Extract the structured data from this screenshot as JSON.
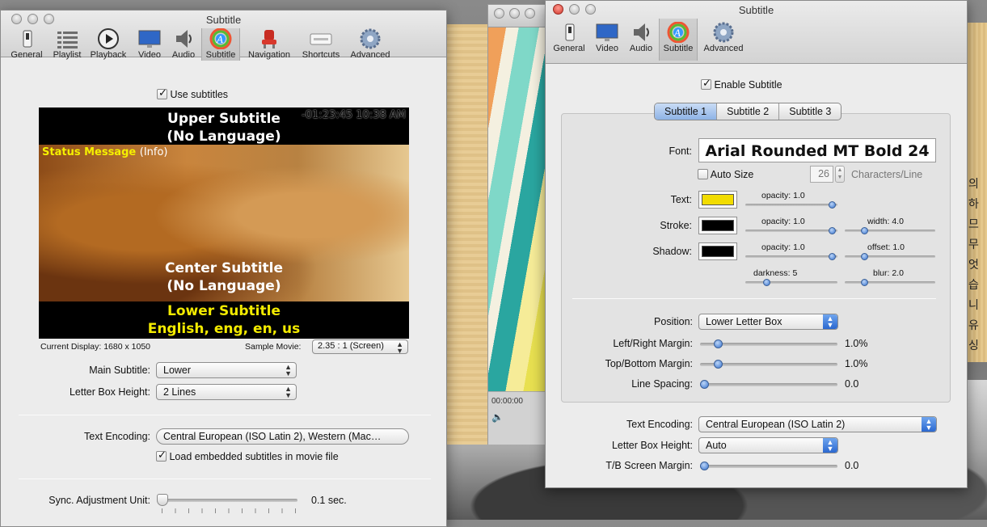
{
  "left_window": {
    "title": "Subtitle",
    "toolbar": [
      {
        "label": "General",
        "icon": "switch-icon"
      },
      {
        "label": "Playlist",
        "icon": "playlist-icon"
      },
      {
        "label": "Playback",
        "icon": "play-icon"
      },
      {
        "label": "Video",
        "icon": "monitor-icon"
      },
      {
        "label": "Audio",
        "icon": "speaker-icon"
      },
      {
        "label": "Subtitle",
        "icon": "color-wheel-icon"
      },
      {
        "label": "Navigation",
        "icon": "chair-icon"
      },
      {
        "label": "Shortcuts",
        "icon": "keyboard-icon"
      },
      {
        "label": "Advanced",
        "icon": "gear-icon"
      }
    ],
    "use_subtitles_label": "Use subtitles",
    "preview": {
      "upper_line1": "Upper Subtitle",
      "upper_line2": "(No Language)",
      "time_overlay": "-01:23:45   10:38 AM",
      "status_message": "Status Message",
      "status_info": "(Info)",
      "center_line1": "Center Subtitle",
      "center_line2": "(No Language)",
      "lower_line1": "Lower Subtitle",
      "lower_line2": "English, eng, en, us"
    },
    "current_display": "Current Display: 1680 x 1050",
    "sample_movie_label": "Sample Movie:",
    "sample_movie_value": "2.35 : 1 (Screen)",
    "main_subtitle_label": "Main Subtitle:",
    "main_subtitle_value": "Lower",
    "letter_box_height_label": "Letter Box Height:",
    "letter_box_height_value": "2 Lines",
    "text_encoding_label": "Text Encoding:",
    "text_encoding_value": "Central European (ISO Latin 2), Western (Mac…",
    "load_embedded_label": "Load embedded subtitles in movie file",
    "sync_label": "Sync. Adjustment Unit:",
    "sync_value": "0.1 sec."
  },
  "movie_window": {
    "time": "00:00:00"
  },
  "right_window": {
    "title": "Subtitle",
    "toolbar": [
      {
        "label": "General",
        "icon": "switch-icon"
      },
      {
        "label": "Video",
        "icon": "monitor-icon"
      },
      {
        "label": "Audio",
        "icon": "speaker-icon"
      },
      {
        "label": "Subtitle",
        "icon": "color-wheel-icon"
      },
      {
        "label": "Advanced",
        "icon": "gear-icon"
      }
    ],
    "enable_subtitle_label": "Enable Subtitle",
    "tabs": [
      "Subtitle 1",
      "Subtitle 2",
      "Subtitle 3"
    ],
    "font_label": "Font:",
    "font_value": "Arial Rounded MT Bold 24",
    "auto_size_label": "Auto Size",
    "chars_value": "26",
    "chars_label": "Characters/Line",
    "text_label": "Text:",
    "text_color": "#f2dc00",
    "text_opacity": "opacity:  1.0",
    "stroke_label": "Stroke:",
    "stroke_color": "#000000",
    "stroke_opacity": "opacity:  1.0",
    "stroke_width": "width:  4.0",
    "shadow_label": "Shadow:",
    "shadow_color": "#000000",
    "shadow_opacity": "opacity:  1.0",
    "shadow_offset": "offset:  1.0",
    "shadow_darkness": "darkness:  5",
    "shadow_blur": "blur:  2.0",
    "position_label": "Position:",
    "position_value": "Lower Letter Box",
    "lr_margin_label": "Left/Right Margin:",
    "lr_margin_value": "1.0%",
    "tb_margin_label": "Top/Bottom Margin:",
    "tb_margin_value": "1.0%",
    "line_spacing_label": "Line Spacing:",
    "line_spacing_value": "0.0",
    "text_encoding_label": "Text Encoding:",
    "text_encoding_value": "Central European (ISO Latin 2)",
    "letter_box_label": "Letter Box Height:",
    "letter_box_value": "Auto",
    "screen_margin_label": "T/B Screen Margin:",
    "screen_margin_value": "0.0"
  },
  "background": {
    "korean_text": [
      "의",
      "하므",
      "무",
      "",
      "",
      "",
      "",
      "엇습니",
      "유싱"
    ]
  }
}
